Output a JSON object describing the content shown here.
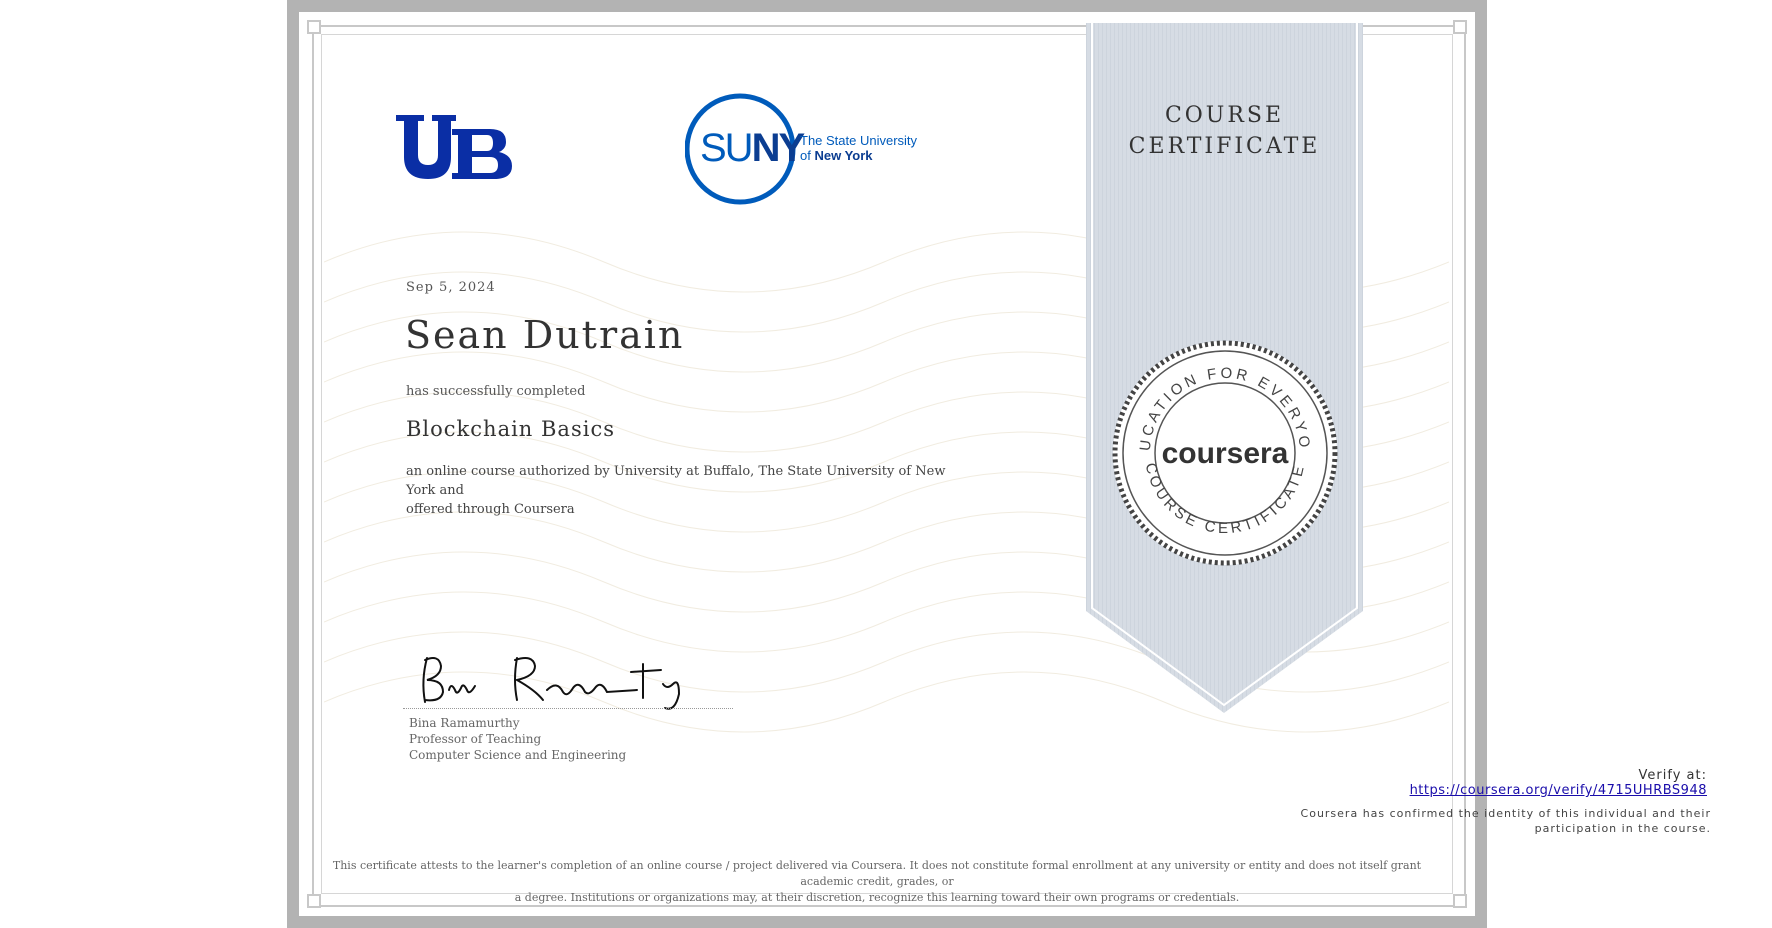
{
  "logos": {
    "ub_letters": "UB",
    "suny_letters_blue": "SU",
    "suny_letters_dark": "NY",
    "suny_tagline_1": "The State University",
    "suny_tagline_2_prefix": "of ",
    "suny_tagline_2_bold": "New York",
    "brand_blue": "#005bbb",
    "ub_blue": "#0a2ea5"
  },
  "ribbon": {
    "title_line1": "COURSE",
    "title_line2": "CERTIFICATE",
    "color": "#d5dbe3"
  },
  "seal": {
    "top_text": "EDUCATION FOR EVERYONE",
    "bottom_text": "COURSE CERTIFICATE",
    "brand": "coursera"
  },
  "certificate": {
    "date": "Sep 5, 2024",
    "recipient": "Sean Dutrain",
    "completed_text": "has successfully completed",
    "course_title": "Blockchain Basics",
    "description_line1": "an online course authorized by University at Buffalo, The State University of New York and",
    "description_line2": "offered through Coursera"
  },
  "signer": {
    "name": "Bina Ramamurthy",
    "title": "Professor of Teaching",
    "department": "Computer Science and Engineering"
  },
  "verification": {
    "label": "Verify at:",
    "url": "https://coursera.org/verify/4715UHRBS948",
    "confirm_line1": "Coursera has confirmed the identity of this individual and their",
    "confirm_line2": "participation in the course."
  },
  "disclaimer": {
    "line1": "This certificate attests to the learner's completion of an online course / project delivered via Coursera. It does not constitute formal enrollment at any university or entity and does not itself grant academic credit, grades, or",
    "line2": "a degree. Institutions or organizations may, at their discretion, recognize this learning toward their own programs or credentials."
  }
}
